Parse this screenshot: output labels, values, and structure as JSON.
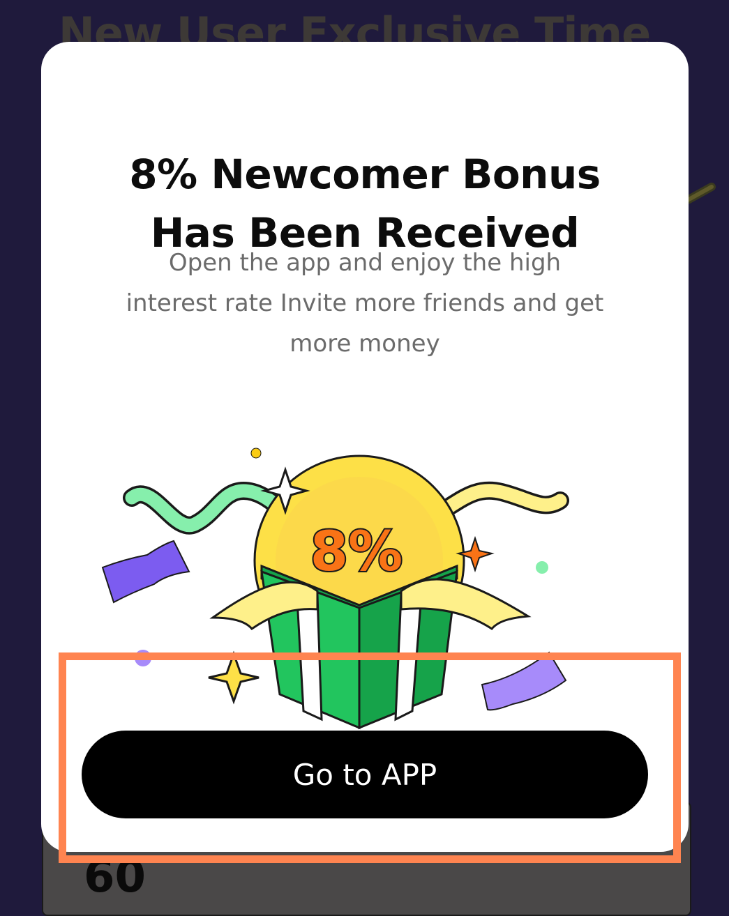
{
  "background": {
    "title": "New User Exclusive Time",
    "number": "60"
  },
  "modal": {
    "title_line1": "8% Newcomer Bonus",
    "title_line2": "Has Been Received",
    "description": "Open the app and enjoy the high interest rate Invite more friends and get more money",
    "badge": "8%",
    "cta_label": "Go to APP"
  },
  "colors": {
    "overlay": "#1f1a3c",
    "button": "#000000",
    "button_text": "#ffffff",
    "gift_green": "#22c55e",
    "coin_yellow": "#fde047",
    "badge_orange": "#f97316",
    "highlight": "#ff8450"
  },
  "icons": [
    "gift-box-icon",
    "coin-icon",
    "sparkle-icon",
    "confetti-icon",
    "ribbon-icon"
  ]
}
